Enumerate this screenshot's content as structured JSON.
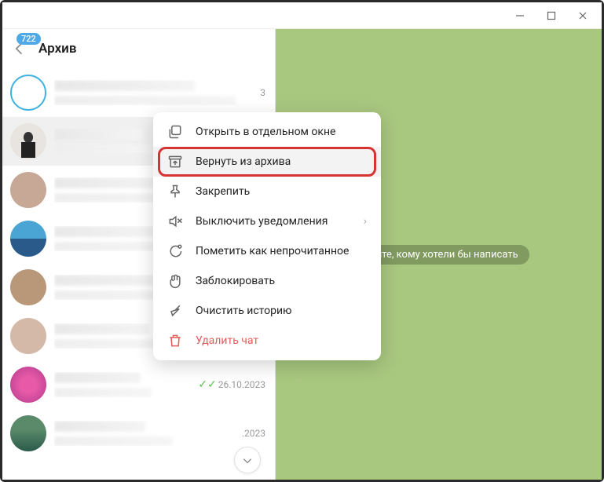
{
  "window": {
    "controls": {
      "min": "—",
      "max": "❐",
      "close": "✕"
    }
  },
  "header": {
    "title": "Архив",
    "badge": "722"
  },
  "chats": [
    {
      "date": "3"
    },
    {
      "date": ""
    },
    {
      "date": ""
    },
    {
      "date": ""
    },
    {
      "date": ""
    },
    {
      "date": ""
    },
    {
      "read": true,
      "date": "26.10.2023"
    },
    {
      "date": ".2023"
    }
  ],
  "menu": {
    "open_window": "Открыть в отдельном окне",
    "unarchive": "Вернуть из архива",
    "pin": "Закрепить",
    "mute": "Выключить уведомления",
    "mark_unread": "Пометить как непрочитанное",
    "block": "Заблокировать",
    "clear": "Очистить историю",
    "delete": "Удалить чат"
  },
  "main": {
    "placeholder": "берите, кому хотели бы написать"
  }
}
